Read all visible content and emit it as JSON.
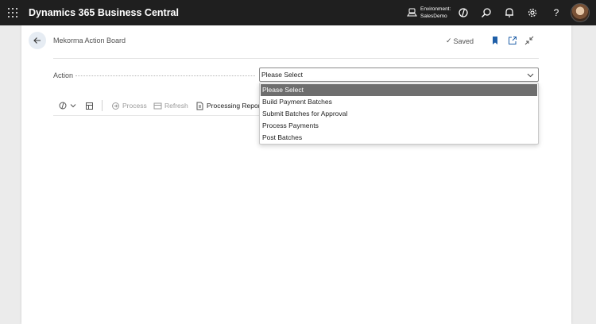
{
  "topbar": {
    "app_title": "Dynamics 365 Business Central",
    "environment_label": "Environment:",
    "environment_value": "SalesDemo",
    "icons": [
      "app-launcher-icon",
      "environment-icon",
      "copilot-icon",
      "search-icon",
      "bell-icon",
      "gear-icon",
      "help-icon"
    ],
    "help_glyph": "?"
  },
  "page": {
    "title": "Mekorma Action Board",
    "saved_label": "Saved",
    "saved_glyph": "✓"
  },
  "form": {
    "action_label": "Action",
    "action_value": "Please Select"
  },
  "toolbar": {
    "process_label": "Process",
    "refresh_label": "Refresh",
    "processing_report_label": "Processing Report"
  },
  "dropdown": {
    "options": [
      "Please Select",
      "Build Payment Batches",
      "Submit Batches for Approval",
      "Process Payments",
      "Post Batches"
    ],
    "selected_index": 0
  },
  "colors": {
    "topbar_bg": "#1f1f1f",
    "bookmark": "#1f5fa8",
    "selected_option_bg": "#6e6e6e"
  }
}
